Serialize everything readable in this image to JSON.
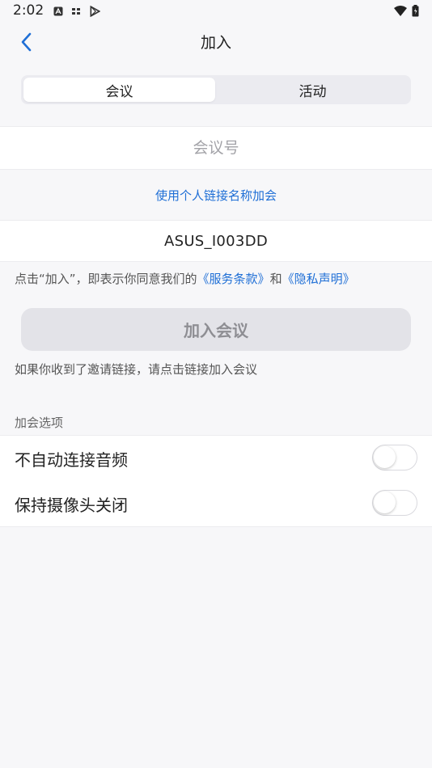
{
  "status": {
    "time": "2:02"
  },
  "nav": {
    "title": "加入"
  },
  "segments": {
    "meeting": "会议",
    "event": "活动"
  },
  "meeting_id": {
    "placeholder": "会议号",
    "value": ""
  },
  "personal_link": "使用个人链接名称加会",
  "display_name": "ASUS_I003DD",
  "terms": {
    "prefix": "点击“加入”，即表示你同意我们的",
    "service_link": "《服务条款》",
    "and": "和",
    "privacy_link": "《隐私声明》"
  },
  "join_button": "加入会议",
  "invite_hint": "如果你收到了邀请链接，请点击链接加入会议",
  "options": {
    "title": "加会选项",
    "items": [
      {
        "label": "不自动连接音频",
        "enabled": false
      },
      {
        "label": "保持摄像头关闭",
        "enabled": false
      }
    ]
  }
}
